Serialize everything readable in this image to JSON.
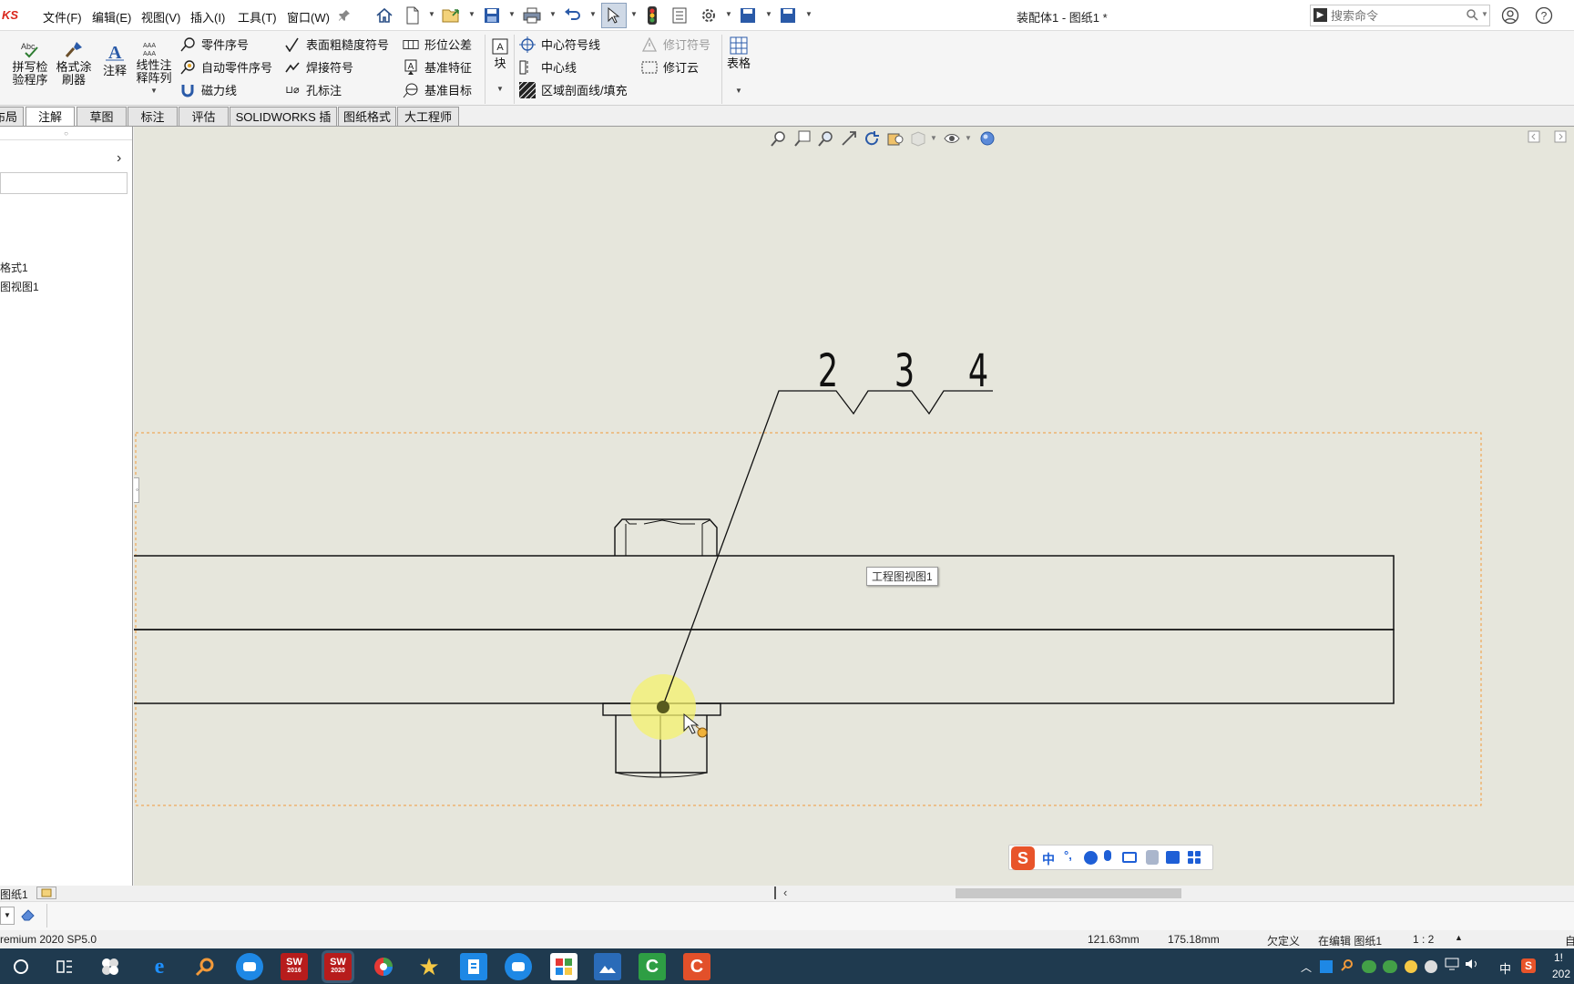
{
  "app": {
    "brand": "KS",
    "title": "装配体1 - 图纸1 *"
  },
  "menu": [
    "文件(F)",
    "编辑(E)",
    "视图(V)",
    "插入(I)",
    "工具(T)",
    "窗口(W)"
  ],
  "search": {
    "placeholder": "搜索命令"
  },
  "ribbon": {
    "spell_check": [
      "拼写检",
      "验程序"
    ],
    "format_painter": [
      "格式涂",
      "刷器"
    ],
    "note": "注释",
    "linear_pattern": [
      "线性注",
      "释阵列"
    ],
    "balloon": "零件序号",
    "auto_balloon": "自动零件序号",
    "magnetic_line": "磁力线",
    "surface_finish": "表面粗糙度符号",
    "weld_symbol": "焊接符号",
    "hole_callout": "孔标注",
    "geo_tolerance": "形位公差",
    "datum_feature": "基准特征",
    "datum_target": "基准目标",
    "block": "块",
    "center_mark": "中心符号线",
    "centerline": "中心线",
    "hatch_fill": "区域剖面线/填充",
    "revision_symbol": "修订符号",
    "revision_cloud": "修订云",
    "table": "表格"
  },
  "tabs": [
    "布局",
    "注解",
    "草图",
    "标注",
    "评估",
    "SOLIDWORKS 插件",
    "图纸格式",
    "大工程师"
  ],
  "tree": {
    "items": [
      "格式1",
      "图视图1"
    ]
  },
  "drawing": {
    "balloons": [
      "2",
      "3",
      "4"
    ],
    "view_tooltip": "工程图视图1"
  },
  "ime": {
    "mode": "中",
    "punct": "°,"
  },
  "sheet_tab": "图纸1",
  "status": {
    "product": "remium 2020 SP5.0",
    "x": "121.63mm",
    "y": "175.18mm",
    "constraint": "欠定义",
    "editing": "在编辑 图纸1",
    "scale": "1 : 2",
    "unit": "自"
  },
  "taskbar": {
    "sw2016": "2016",
    "sw2020": "2020",
    "tray_lang": "中",
    "clock_time": "1!",
    "clock_date": "202"
  },
  "colors": {
    "canvas": "#e6e6dc",
    "highlight": "#f4f26e",
    "sheet_border": "#f39a3a",
    "taskbar": "#1f3a4f"
  }
}
